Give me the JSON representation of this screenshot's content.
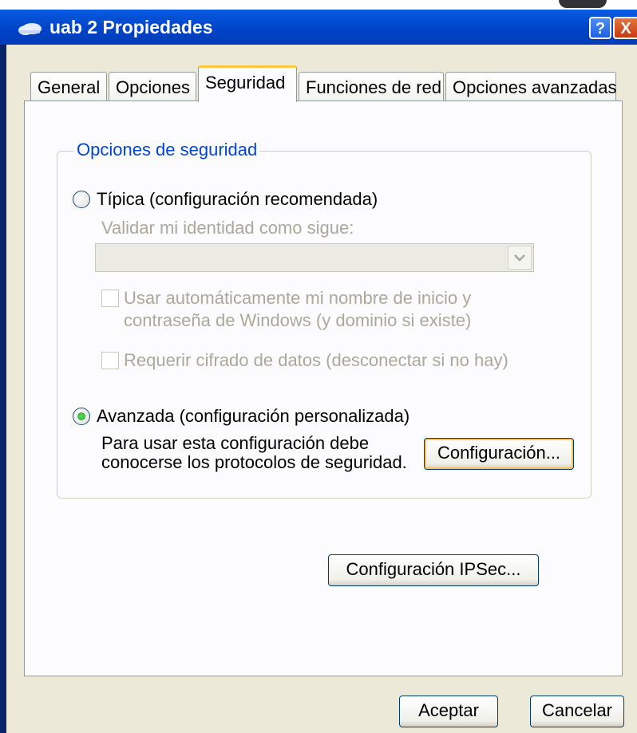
{
  "window": {
    "title": "uab 2 Propiedades",
    "help_label": "?",
    "close_label": "X"
  },
  "tabs": [
    {
      "label": "General"
    },
    {
      "label": "Opciones"
    },
    {
      "label": "Seguridad"
    },
    {
      "label": "Funciones de red"
    },
    {
      "label": "Opciones avanzadas"
    }
  ],
  "active_tab": "Seguridad",
  "security": {
    "group_title": "Opciones de seguridad",
    "typical_label": "Típica (configuración recomendada)",
    "typical_selected": false,
    "validate_label": "Validar mi identidad como sigue:",
    "validate_value": "",
    "auto_logon_line1": "Usar automáticamente  mi nombre de inicio y",
    "auto_logon_line2": "contraseña de Windows (y dominio si existe)",
    "require_encryption_label": "Requerir cifrado de datos (desconectar si no hay)",
    "advanced_label": "Avanzada (configuración personalizada)",
    "advanced_selected": true,
    "advanced_desc_line1": "Para usar esta configuración debe",
    "advanced_desc_line2": "conocerse los protocolos de seguridad.",
    "settings_button": "Configuración..."
  },
  "ipsec_button": "Configuración IPSec...",
  "footer": {
    "ok_button": "Aceptar",
    "cancel_button": "Cancelar"
  },
  "colors": {
    "titlebar": "#0044c8",
    "dialog_bg": "#ece9d8",
    "group_title": "#0046d5",
    "disabled_text": "#aca899"
  }
}
